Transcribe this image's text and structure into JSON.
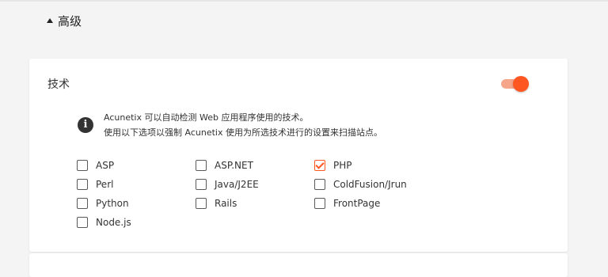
{
  "advanced": {
    "title": "高级"
  },
  "technologies": {
    "title": "技术",
    "enabled": true,
    "info_line1": "Acunetix 可以自动检测 Web 应用程序使用的技术。",
    "info_line2": "使用以下选项以强制 Acunetix 使用为所选技术进行的设置来扫描站点。",
    "items": [
      {
        "label": "ASP",
        "checked": false
      },
      {
        "label": "ASP.NET",
        "checked": false
      },
      {
        "label": "PHP",
        "checked": true
      },
      {
        "label": "Perl",
        "checked": false
      },
      {
        "label": "Java/J2EE",
        "checked": false
      },
      {
        "label": "ColdFusion/Jrun",
        "checked": false
      },
      {
        "label": "Python",
        "checked": false
      },
      {
        "label": "Rails",
        "checked": false
      },
      {
        "label": "FrontPage",
        "checked": false
      },
      {
        "label": "Node.js",
        "checked": false
      }
    ]
  },
  "colors": {
    "accent": "#ff5722",
    "toggle_track": "#f5a58a",
    "background": "#f4f4f4"
  }
}
